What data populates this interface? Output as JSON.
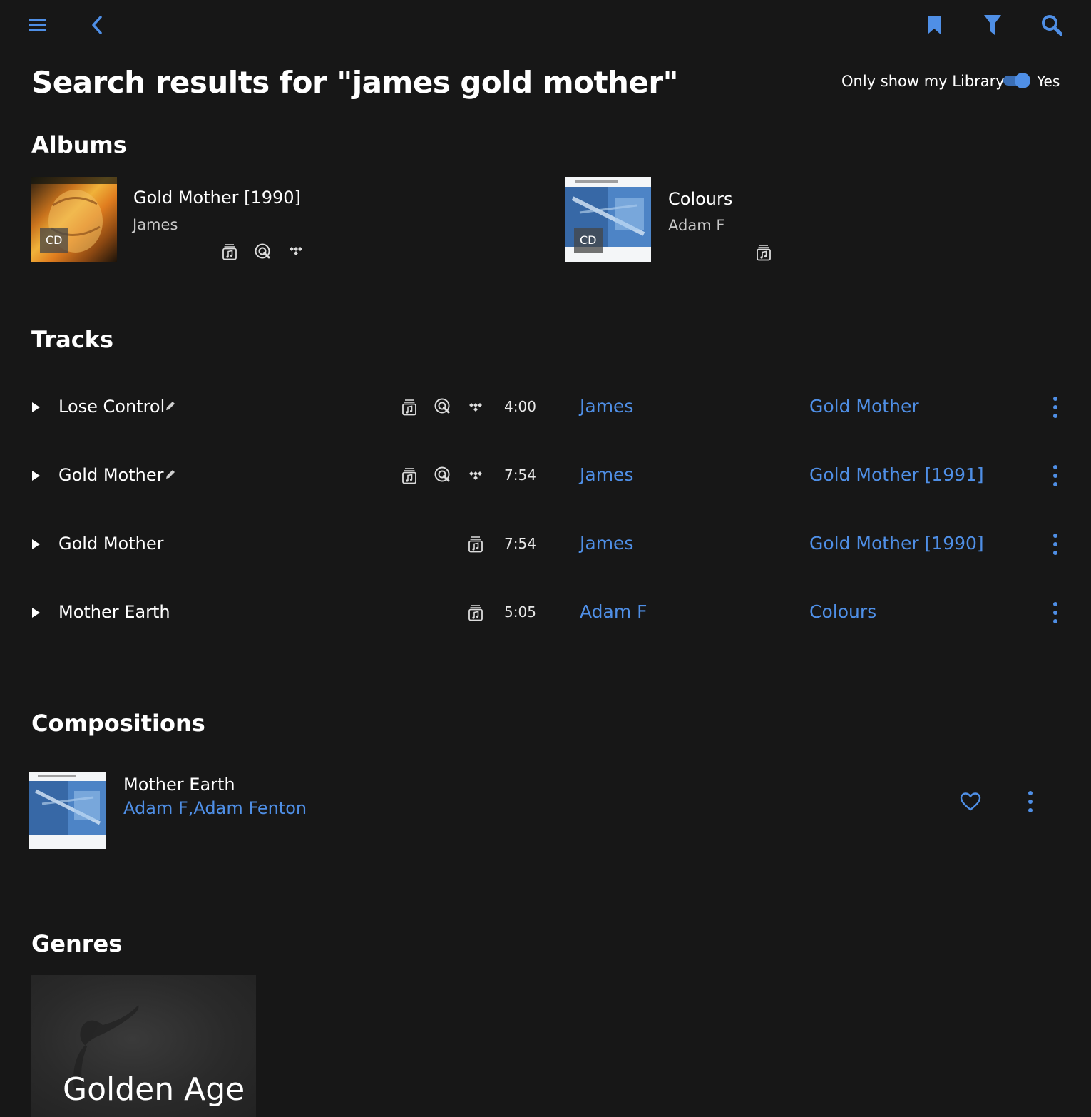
{
  "header": {
    "menu_icon": "hamburger-menu-icon",
    "back_icon": "chevron-left-icon",
    "bookmark_icon": "bookmark-icon",
    "filter_icon": "funnel-icon",
    "search_icon": "search-icon",
    "accent_color": "#4f8fe6"
  },
  "page": {
    "title": "Search results for \"james gold mother\"",
    "library_toggle_label": "Only show my Library",
    "library_toggle_value": "Yes",
    "library_toggle_on": true
  },
  "albums": {
    "section_title": "Albums",
    "items": [
      {
        "title": "Gold Mother [1990]",
        "artist": "James",
        "badge": "CD",
        "sources": [
          "library-icon",
          "qobuz-icon",
          "tidal-icon"
        ]
      },
      {
        "title": "Colours",
        "artist": "Adam F",
        "badge": "CD",
        "sources": [
          "library-icon"
        ]
      }
    ]
  },
  "tracks": {
    "section_title": "Tracks",
    "items": [
      {
        "title": "Lose Control",
        "duration": "4:00",
        "artist": "James",
        "album": "Gold Mother",
        "edited": true,
        "sources": [
          "library-icon",
          "qobuz-icon",
          "tidal-icon"
        ]
      },
      {
        "title": "Gold Mother",
        "duration": "7:54",
        "artist": "James",
        "album": "Gold Mother [1991]",
        "edited": true,
        "sources": [
          "library-icon",
          "qobuz-icon",
          "tidal-icon"
        ]
      },
      {
        "title": "Gold Mother",
        "duration": "7:54",
        "artist": "James",
        "album": "Gold Mother [1990]",
        "edited": false,
        "sources": [
          "library-icon"
        ]
      },
      {
        "title": "Mother Earth",
        "duration": "5:05",
        "artist": "Adam F",
        "album": "Colours",
        "edited": false,
        "sources": [
          "library-icon"
        ]
      }
    ]
  },
  "compositions": {
    "section_title": "Compositions",
    "items": [
      {
        "title": "Mother Earth",
        "composers": "Adam F,Adam Fenton",
        "favorite": false
      }
    ]
  },
  "genres": {
    "section_title": "Genres",
    "items": [
      {
        "name": "Golden Age"
      }
    ]
  }
}
